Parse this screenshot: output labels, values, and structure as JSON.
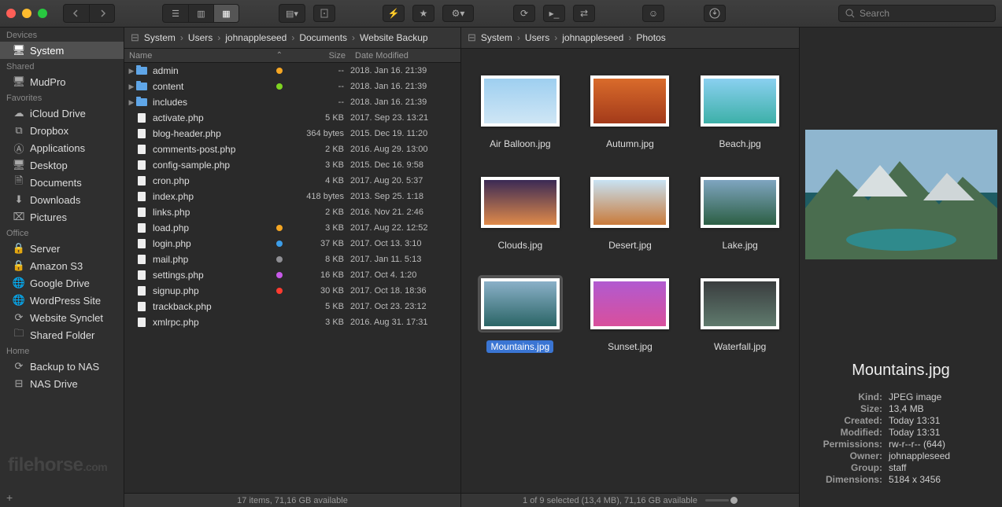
{
  "search": {
    "placeholder": "Search"
  },
  "sidebar": {
    "devices": {
      "header": "Devices",
      "items": [
        {
          "label": "System",
          "icon": "desktop"
        }
      ]
    },
    "shared": {
      "header": "Shared",
      "items": [
        {
          "label": "MudPro",
          "icon": "desktop"
        }
      ]
    },
    "favorites": {
      "header": "Favorites",
      "items": [
        {
          "label": "iCloud Drive",
          "icon": "cloud"
        },
        {
          "label": "Dropbox",
          "icon": "dropbox"
        },
        {
          "label": "Applications",
          "icon": "apps"
        },
        {
          "label": "Desktop",
          "icon": "desktop"
        },
        {
          "label": "Documents",
          "icon": "docs"
        },
        {
          "label": "Downloads",
          "icon": "download"
        },
        {
          "label": "Pictures",
          "icon": "photo"
        }
      ]
    },
    "office": {
      "header": "Office",
      "items": [
        {
          "label": "Server",
          "icon": "lock"
        },
        {
          "label": "Amazon S3",
          "icon": "lock"
        },
        {
          "label": "Google Drive",
          "icon": "globe"
        },
        {
          "label": "WordPress Site",
          "icon": "globe"
        },
        {
          "label": "Website Synclet",
          "icon": "sync"
        },
        {
          "label": "Shared Folder",
          "icon": "folder"
        }
      ]
    },
    "home": {
      "header": "Home",
      "items": [
        {
          "label": "Backup to NAS",
          "icon": "sync"
        },
        {
          "label": "NAS Drive",
          "icon": "drive"
        }
      ]
    }
  },
  "list_pane": {
    "path": [
      "System",
      "Users",
      "johnappleseed",
      "Documents",
      "Website Backup"
    ],
    "cols": {
      "name": "Name",
      "size": "Size",
      "date": "Date Modified"
    },
    "files": [
      {
        "type": "folder",
        "name": "admin",
        "size": "--",
        "date": "2018. Jan 16. 21:39",
        "tag": "#f5a623"
      },
      {
        "type": "folder",
        "name": "content",
        "size": "--",
        "date": "2018. Jan 16. 21:39",
        "tag": "#7ed321"
      },
      {
        "type": "folder",
        "name": "includes",
        "size": "--",
        "date": "2018. Jan 16. 21:39",
        "tag": ""
      },
      {
        "type": "file",
        "name": "activate.php",
        "size": "5 KB",
        "date": "2017. Sep 23. 13:21",
        "tag": ""
      },
      {
        "type": "file",
        "name": "blog-header.php",
        "size": "364 bytes",
        "date": "2015. Dec 19. 11:20",
        "tag": ""
      },
      {
        "type": "file",
        "name": "comments-post.php",
        "size": "2 KB",
        "date": "2016. Aug 29. 13:00",
        "tag": ""
      },
      {
        "type": "file",
        "name": "config-sample.php",
        "size": "3 KB",
        "date": "2015. Dec 16. 9:58",
        "tag": ""
      },
      {
        "type": "file",
        "name": "cron.php",
        "size": "4 KB",
        "date": "2017. Aug 20. 5:37",
        "tag": ""
      },
      {
        "type": "file",
        "name": "index.php",
        "size": "418 bytes",
        "date": "2013. Sep 25. 1:18",
        "tag": ""
      },
      {
        "type": "file",
        "name": "links.php",
        "size": "2 KB",
        "date": "2016. Nov 21. 2:46",
        "tag": ""
      },
      {
        "type": "file",
        "name": "load.php",
        "size": "3 KB",
        "date": "2017. Aug 22. 12:52",
        "tag": "#f5a623"
      },
      {
        "type": "file",
        "name": "login.php",
        "size": "37 KB",
        "date": "2017. Oct 13. 3:10",
        "tag": "#3c9de8"
      },
      {
        "type": "file",
        "name": "mail.php",
        "size": "8 KB",
        "date": "2017. Jan 11. 5:13",
        "tag": "#8e8e93"
      },
      {
        "type": "file",
        "name": "settings.php",
        "size": "16 KB",
        "date": "2017. Oct 4. 1:20",
        "tag": "#c759e8"
      },
      {
        "type": "file",
        "name": "signup.php",
        "size": "30 KB",
        "date": "2017. Oct 18. 18:36",
        "tag": "#ff3b30"
      },
      {
        "type": "file",
        "name": "trackback.php",
        "size": "5 KB",
        "date": "2017. Oct 23. 23:12",
        "tag": ""
      },
      {
        "type": "file",
        "name": "xmlrpc.php",
        "size": "3 KB",
        "date": "2016. Aug 31. 17:31",
        "tag": ""
      }
    ],
    "status": "17 items, 71,16 GB available"
  },
  "grid_pane": {
    "path": [
      "System",
      "Users",
      "johnappleseed",
      "Photos"
    ],
    "photos": [
      {
        "name": "Air Balloon.jpg",
        "bg": "linear-gradient(#9ecff0,#cfe6f5)"
      },
      {
        "name": "Autumn.jpg",
        "bg": "linear-gradient(#d96b2b,#a33a1a)"
      },
      {
        "name": "Beach.jpg",
        "bg": "linear-gradient(#8ad0f0,#3db0a8)"
      },
      {
        "name": "Clouds.jpg",
        "bg": "linear-gradient(#3b2a55,#e08a4a)"
      },
      {
        "name": "Desert.jpg",
        "bg": "linear-gradient(#c8e2f3,#c97a3a)"
      },
      {
        "name": "Lake.jpg",
        "bg": "linear-gradient(#7fa5c0,#2c5f44)"
      },
      {
        "name": "Mountains.jpg",
        "bg": "linear-gradient(#8ab0c8,#2b6566)",
        "selected": true
      },
      {
        "name": "Sunset.jpg",
        "bg": "linear-gradient(#b15ad0,#d94f9c)"
      },
      {
        "name": "Waterfall.jpg",
        "bg": "linear-gradient(#3a3d3f,#5f7a6d)"
      }
    ],
    "status": "1 of 9 selected (13,4 MB), 71,16 GB available"
  },
  "info": {
    "title": "Mountains.jpg",
    "rows": [
      {
        "k": "Kind:",
        "v": "JPEG image"
      },
      {
        "k": "Size:",
        "v": "13,4 MB"
      },
      {
        "k": "Created:",
        "v": "Today 13:31"
      },
      {
        "k": "Modified:",
        "v": "Today 13:31"
      },
      {
        "k": "Permissions:",
        "v": "rw-r--r-- (644)"
      },
      {
        "k": "Owner:",
        "v": "johnappleseed"
      },
      {
        "k": "Group:",
        "v": "staff"
      },
      {
        "k": "Dimensions:",
        "v": "5184 x 3456"
      }
    ]
  }
}
